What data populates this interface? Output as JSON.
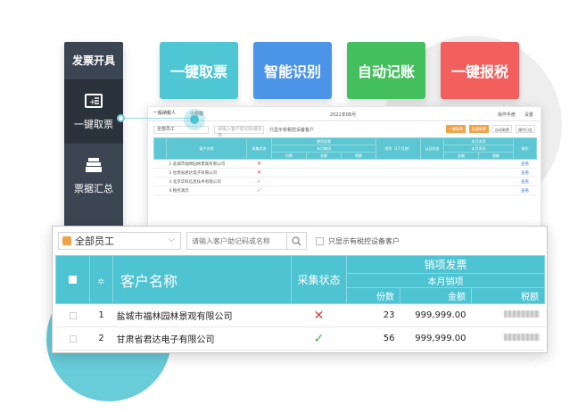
{
  "side_menu": {
    "title": "发票开具",
    "items": [
      {
        "label": "一键取票",
        "icon": "ticket-icon",
        "active": true
      },
      {
        "label": "票据汇总",
        "icon": "invoice-stack-icon",
        "active": false
      }
    ]
  },
  "features": [
    {
      "label": "一键取票",
      "color": "#4ec6d3"
    },
    {
      "label": "智能识别",
      "color": "#4c94e8"
    },
    {
      "label": "自动记账",
      "color": "#44bf5d"
    },
    {
      "label": "一键报税",
      "color": "#f25f5c"
    }
  ],
  "mini": {
    "tabs": [
      "一般纳税人",
      "小规模"
    ],
    "date": "2021年08月",
    "right_links": [
      "操作手册",
      "设置"
    ],
    "select": "全部员工",
    "search_placeholder": "请输入客户助记码或名称",
    "checkbox_label": "只显示有税控设备客户",
    "buttons": [
      "一键取票",
      "批量取票",
      "自动取票",
      "操作日志"
    ],
    "headers": [
      "客户名称",
      "采集状态",
      "销项发票",
      "本月销项",
      "份数",
      "金额",
      "税额",
      "进项（17-月底）",
      "认证状态",
      "本月进项",
      "操作"
    ],
    "rows": [
      {
        "name": "1 盐城市福林园林景观有限公司",
        "status": "x",
        "op": "查看"
      },
      {
        "name": "2 甘肃省君达电子有限公司",
        "status": "x",
        "op": "查看"
      },
      {
        "name": "3 北京华科信息技术有限公司",
        "status": "v",
        "op": "查看"
      },
      {
        "name": "4 税务演示",
        "status": "v",
        "op": "查看"
      }
    ]
  },
  "zoom": {
    "select": "全部员工",
    "search_placeholder": "请输入客户助记码或名称",
    "checkbox_label": "只显示有税控设备客户",
    "headers": {
      "customer": "客户名称",
      "status": "采集状态",
      "sales_invoice": "销项发票",
      "month_sales": "本月销项",
      "count": "份数",
      "amount": "金额",
      "tax": "税额"
    },
    "rows": [
      {
        "index": "1",
        "name": "盐城市福林园林景观有限公司",
        "status": "x",
        "count": "23",
        "amount": "999,999.00"
      },
      {
        "index": "2",
        "name": "甘肃省君达电子有限公司",
        "status": "v",
        "count": "56",
        "amount": "999,999.00"
      }
    ]
  }
}
